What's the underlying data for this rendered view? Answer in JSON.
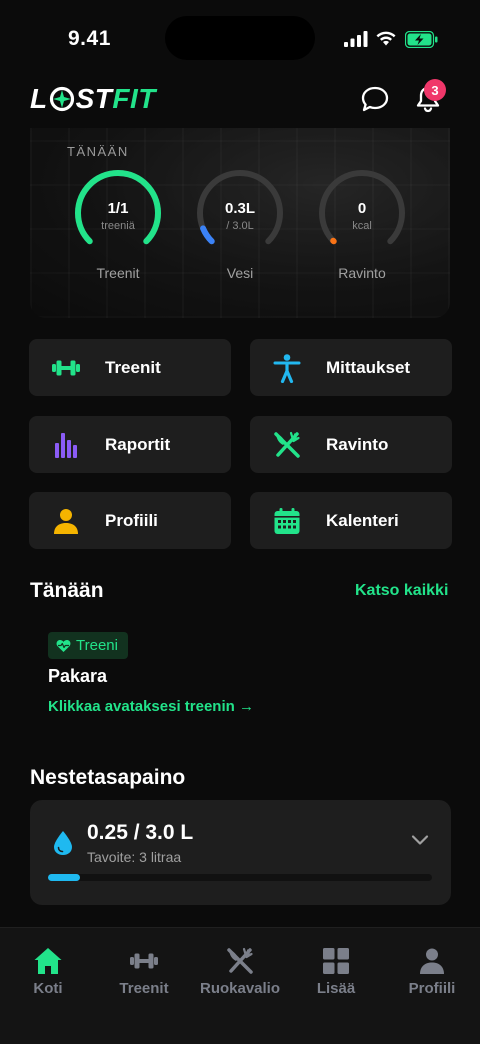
{
  "status": {
    "time": "9.41"
  },
  "header": {
    "logo_part1": "L",
    "logo_part2": "ST",
    "logo_part3": "FIT",
    "notification_count": "3"
  },
  "hero": {
    "label": "TÄNÄÄN",
    "rings": [
      {
        "value": "1/1",
        "sub": "treeniä",
        "label": "Treenit",
        "progress": 1.0,
        "color": "#22e38a"
      },
      {
        "value": "0.3L",
        "sub": "/ 3.0L",
        "label": "Vesi",
        "progress": 0.083,
        "color": "#3b82f6"
      },
      {
        "value": "0",
        "sub": "kcal",
        "label": "Ravinto",
        "progress": 0.0,
        "color": "#f97316"
      }
    ]
  },
  "tiles": [
    {
      "label": "Treenit",
      "icon": "dumbbell-icon",
      "color": "#22e38a"
    },
    {
      "label": "Mittaukset",
      "icon": "person-icon",
      "color": "#22b8f0"
    },
    {
      "label": "Raportit",
      "icon": "bar-chart-icon",
      "color": "#8b5cf6"
    },
    {
      "label": "Ravinto",
      "icon": "fork-knife-icon",
      "color": "#22e38a"
    },
    {
      "label": "Profiili",
      "icon": "user-icon",
      "color": "#f5b400"
    },
    {
      "label": "Kalenteri",
      "icon": "calendar-icon",
      "color": "#22e38a"
    }
  ],
  "today": {
    "title": "Tänään",
    "see_all": "Katso kaikki",
    "tag": "Treeni",
    "workout": "Pakara",
    "open_link": "Klikkaa avataksesi treenin →"
  },
  "hydration": {
    "title": "Nestetasapaino",
    "amount": "0.25 / 3.0 L",
    "goal": "Tavoite: 3 litraa",
    "progress": 0.083
  },
  "nav": [
    {
      "label": "Koti",
      "icon": "home-icon",
      "active": true
    },
    {
      "label": "Treenit",
      "icon": "dumbbell-icon",
      "active": false
    },
    {
      "label": "Ruokavalio",
      "icon": "fork-knife-icon",
      "active": false
    },
    {
      "label": "Lisää",
      "icon": "grid-icon",
      "active": false
    },
    {
      "label": "Profiili",
      "icon": "user-icon",
      "active": false
    }
  ],
  "colors": {
    "accent": "#22e38a",
    "badge": "#f0376a",
    "water": "#1fb9f0"
  }
}
